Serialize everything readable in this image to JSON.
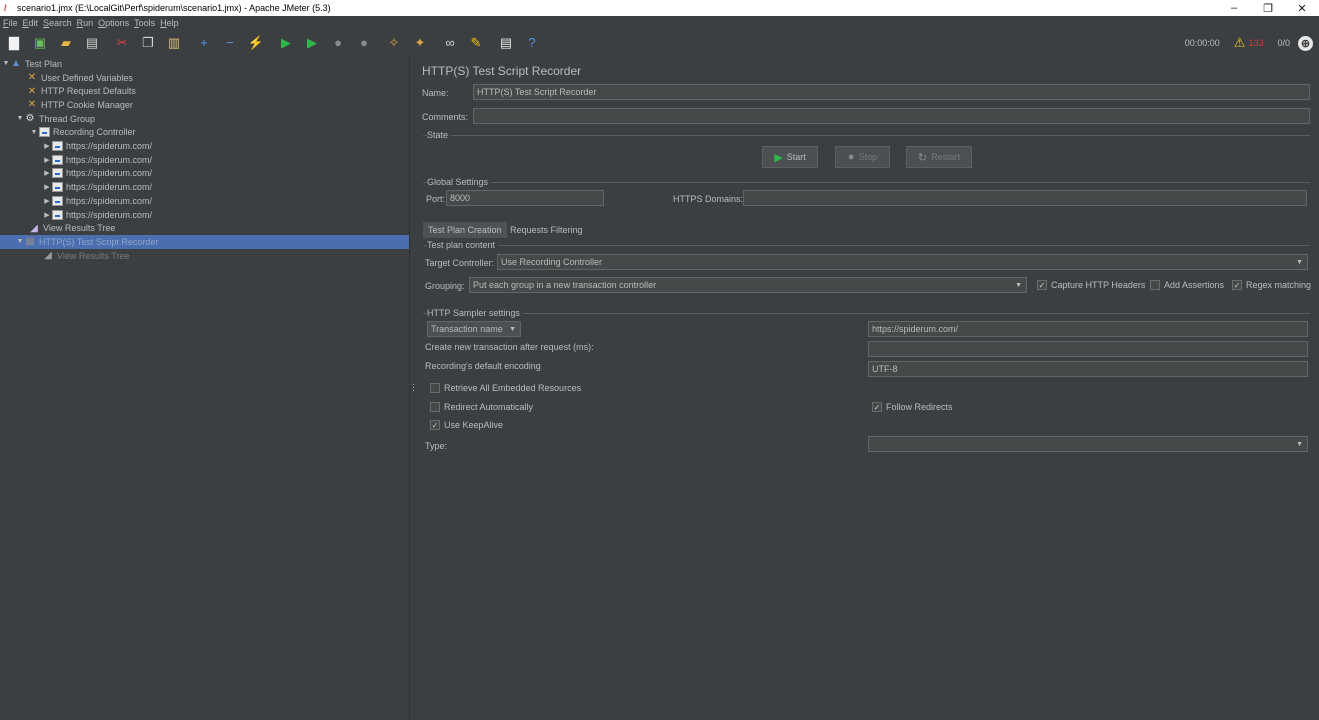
{
  "window": {
    "title": "scenario1.jmx (E:\\LocalGit\\Perf\\spiderum\\scenario1.jmx) - Apache JMeter (5.3)",
    "minimize": "–",
    "restore": "❐",
    "close": "✕"
  },
  "menu": [
    {
      "u": "F",
      "rest": "ile"
    },
    {
      "u": "E",
      "rest": "dit"
    },
    {
      "u": "S",
      "rest": "earch"
    },
    {
      "u": "R",
      "rest": "un"
    },
    {
      "u": "O",
      "rest": "ptions"
    },
    {
      "u": "T",
      "rest": "ools"
    },
    {
      "u": "H",
      "rest": "elp"
    }
  ],
  "toolbar": {
    "timer": "00:00:00",
    "error_count": "133",
    "threads": "0/0"
  },
  "tree": [
    {
      "label": "Test Plan",
      "arrow": "▼",
      "icon": "▲",
      "iconColor": "#5b8fd6"
    },
    {
      "label": "User Defined Variables",
      "arrow": "",
      "icon": "✕",
      "iconColor": "#d9a441"
    },
    {
      "label": "HTTP Request Defaults",
      "arrow": "",
      "icon": "✕",
      "iconColor": "#d9a441"
    },
    {
      "label": "HTTP Cookie Manager",
      "arrow": "",
      "icon": "✕",
      "iconColor": "#d9a441"
    },
    {
      "label": "Thread Group",
      "arrow": "▼",
      "icon": "⚙",
      "iconColor": "#d8d8d8"
    },
    {
      "label": "Recording Controller",
      "arrow": "▼",
      "icon": "sampler",
      "iconColor": "#e8e8e8"
    },
    {
      "label": "https://spiderum.com/",
      "arrow": "▶",
      "icon": "sampler",
      "iconColor": "#e8e8e8"
    },
    {
      "label": "https://spiderum.com/",
      "arrow": "▶",
      "icon": "sampler",
      "iconColor": "#e8e8e8"
    },
    {
      "label": "https://spiderum.com/",
      "arrow": "▶",
      "icon": "sampler",
      "iconColor": "#e8e8e8"
    },
    {
      "label": "https://spiderum.com/",
      "arrow": "▶",
      "icon": "sampler",
      "iconColor": "#e8e8e8"
    },
    {
      "label": "https://spiderum.com/",
      "arrow": "▶",
      "icon": "sampler",
      "iconColor": "#e8e8e8"
    },
    {
      "label": "https://spiderum.com/",
      "arrow": "▶",
      "icon": "sampler",
      "iconColor": "#e8e8e8"
    },
    {
      "label": "View Results Tree",
      "arrow": "",
      "icon": "◢",
      "iconColor": "#c8b6e8"
    },
    {
      "label": "HTTP(S) Test Script Recorder",
      "arrow": "▼",
      "icon": "▦",
      "iconColor": "#8a8a8a"
    },
    {
      "label": "View Results Tree",
      "arrow": "",
      "icon": "◢",
      "iconColor": "#9a9a9a"
    }
  ],
  "panel": {
    "title": "HTTP(S) Test Script Recorder",
    "name_label": "Name:",
    "name_value": "HTTP(S) Test Script Recorder",
    "comments_label": "Comments:",
    "comments_value": "",
    "state_title": "State",
    "start_label": "Start",
    "stop_label": "Stop",
    "restart_label": "Restart",
    "global_title": "Global Settings",
    "port_label": "Port:",
    "port_value": "8000",
    "https_domains_label": "HTTPS Domains:",
    "https_domains_value": "",
    "tab_creation": "Test Plan Creation",
    "tab_filtering": "Requests Filtering",
    "test_plan_content_title": "Test plan content",
    "target_controller_label": "Target Controller:",
    "target_controller_value": "Use Recording Controller",
    "grouping_label": "Grouping:",
    "grouping_value": "Put each group in a new transaction controller",
    "capture_headers_label": "Capture HTTP Headers",
    "capture_headers_checked": true,
    "add_assertions_label": "Add Assertions",
    "add_assertions_checked": false,
    "regex_matching_label": "Regex matching",
    "regex_matching_checked": true,
    "sampler_settings_title": "HTTP Sampler settings",
    "naming_value": "Transaction name",
    "naming_field_value": "https://spiderum.com/",
    "create_transaction_label": "Create new transaction after request (ms):",
    "create_transaction_value": "",
    "encoding_label": "Recording's default encoding",
    "encoding_value": "UTF-8",
    "retrieve_embedded_label": "Retrieve All Embedded Resources",
    "retrieve_embedded_checked": false,
    "redirect_auto_label": "Redirect Automatically",
    "redirect_auto_checked": false,
    "follow_redirects_label": "Follow Redirects",
    "follow_redirects_checked": true,
    "keepalive_label": "Use KeepAlive",
    "keepalive_checked": true,
    "type_label": "Type:",
    "type_value": ""
  }
}
